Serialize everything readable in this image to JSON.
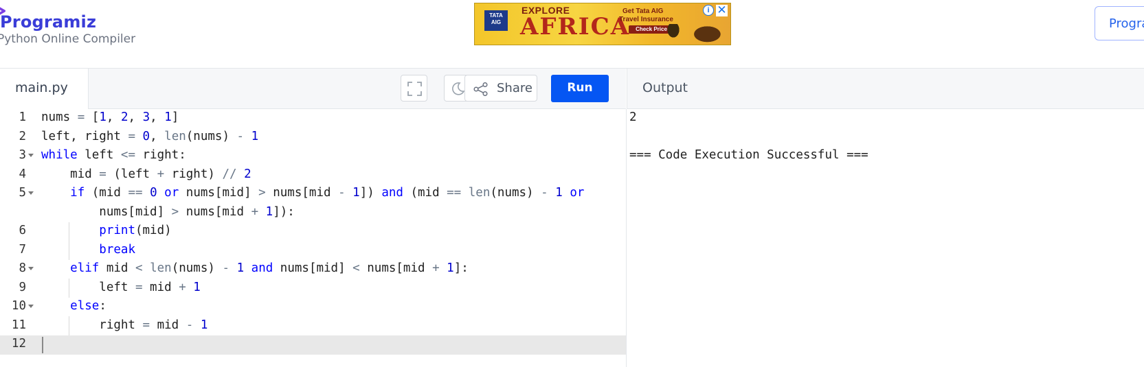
{
  "header": {
    "logo_text": "Programiz",
    "subtitle": "Python Online Compiler",
    "right_button": "Progra"
  },
  "ad": {
    "brand": "TATA AIG",
    "explore": "EXPLORE",
    "africa": "AFRICA",
    "line1": "Get Tata AIG",
    "line2": "Travel Insurance",
    "cta": "Check Price",
    "info": "i",
    "close": "✕"
  },
  "toolbar": {
    "tab_label": "main.py",
    "share_label": "Share",
    "run_label": "Run"
  },
  "output": {
    "title": "Output",
    "lines": [
      "2",
      "",
      "=== Code Execution Successful ==="
    ]
  },
  "editor": {
    "active_line": 12,
    "line_numbers": [
      "1",
      "2",
      "3",
      "4",
      "5",
      "6",
      "7",
      "8",
      "9",
      "10",
      "11",
      "12"
    ]
  },
  "colors": {
    "accent": "#0556f3",
    "brand": "#3a3dd8",
    "keyword": "#0000ff",
    "number": "#0000cd",
    "operator": "#687687"
  }
}
